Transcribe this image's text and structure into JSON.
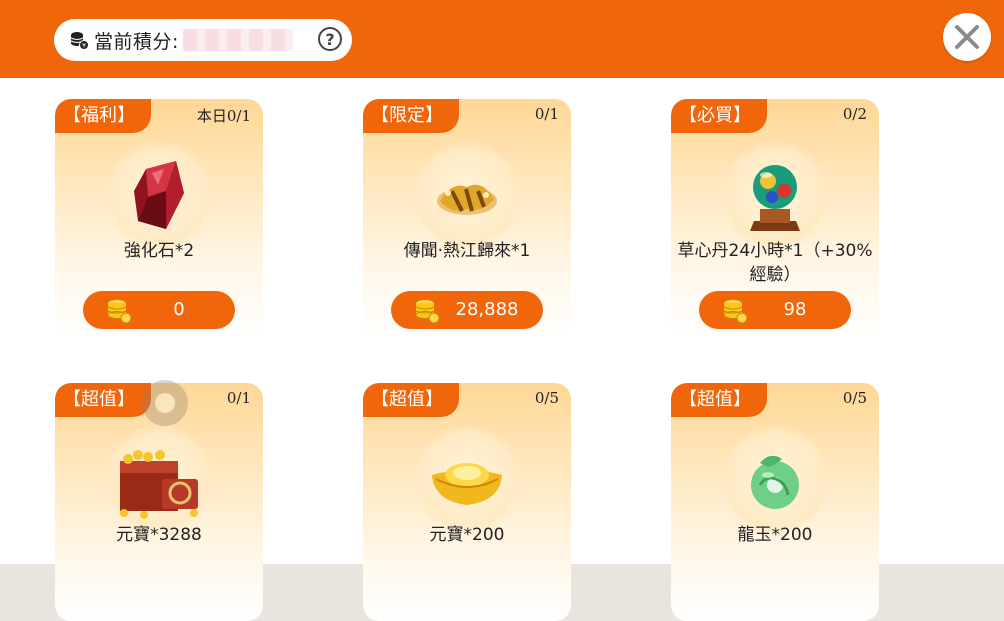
{
  "header": {
    "points_label": "當前積分:",
    "help_symbol": "?",
    "close_symbol": "✕"
  },
  "items": [
    {
      "tag": "【福利】",
      "limit": "本日0/1",
      "name": "強化石*2",
      "price": "0",
      "icon": "red-gem-icon"
    },
    {
      "tag": "【限定】",
      "limit": "0/1",
      "name": "傳聞·熱江歸來*1",
      "price": "28,888",
      "icon": "golden-title-icon"
    },
    {
      "tag": "【必買】",
      "limit": "0/2",
      "name": "草心丹24小時*1（+30%經驗）",
      "price": "98",
      "icon": "crystal-orb-icon"
    },
    {
      "tag": "【超值】",
      "limit": "0/1",
      "name": "元寶*3288",
      "price": "",
      "icon": "treasure-chest-icon"
    },
    {
      "tag": "【超值】",
      "limit": "0/5",
      "name": "元寶*200",
      "price": "",
      "icon": "gold-ingot-icon"
    },
    {
      "tag": "【超值】",
      "limit": "0/5",
      "name": "龍玉*200",
      "price": "",
      "icon": "jade-dragon-icon"
    }
  ],
  "colors": {
    "accent": "#f1660b",
    "card_top": "#ffd795",
    "card_bottom": "#ffffff"
  }
}
